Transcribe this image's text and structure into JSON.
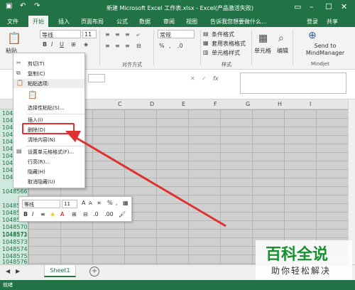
{
  "window": {
    "title": "新建 Microsoft Excel 工作表.xlsx - Excel(产品激活失败)",
    "login": "登录",
    "share": "共享"
  },
  "tabs": [
    "文件",
    "开始",
    "插入",
    "页面布局",
    "公式",
    "数据",
    "审阅",
    "视图",
    "告诉我您想要做什么..."
  ],
  "ribbon": {
    "paste_label": "粘贴",
    "font_name": "等线",
    "font_size": "11",
    "number_format": "常规",
    "group_alignment": "对齐方式",
    "group_styles": "样式",
    "group_mindjet": "Mindjet",
    "conditional_format": "条件格式",
    "table_format": "套用表格格式",
    "cell_styles": "单元格样式",
    "cells_label": "单元格",
    "edit_label": "编辑",
    "mindmanager_label": "Send to MindManager"
  },
  "sheet": {
    "columns": [
      "C",
      "D",
      "E",
      "F",
      "G",
      "H",
      "I"
    ],
    "rows": [
      "1048",
      "1048",
      "1048",
      "1048",
      "1048",
      "1048",
      "1048",
      "1048",
      "1048",
      "1048",
      "1048566",
      "1048567",
      "1048568",
      "1048569",
      "1048570",
      "1048571",
      "1048572",
      "1048573",
      "1048574",
      "1048575",
      "1048576"
    ],
    "tab_name": "Sheet1",
    "status": "就绪"
  },
  "context_menu": {
    "cut": "剪切(T)",
    "copy": "复制(C)",
    "paste_options": "粘贴选项:",
    "paste_special": "选择性粘贴(S)...",
    "insert": "插入(I)",
    "delete": "删除(D)",
    "clear": "清除内容(N)",
    "format_cells": "设置单元格格式(F)...",
    "row_height": "行高(R)...",
    "hide": "隐藏(H)",
    "unhide": "取消隐藏(U)"
  },
  "mini_toolbar": {
    "font": "等线",
    "size": "11"
  },
  "watermark": {
    "title": "百科全说",
    "subtitle": "助你轻松解决"
  },
  "colors": {
    "excel_green": "#217346",
    "highlight_red": "#e03030",
    "watermark_green": "#1a8f2f"
  }
}
